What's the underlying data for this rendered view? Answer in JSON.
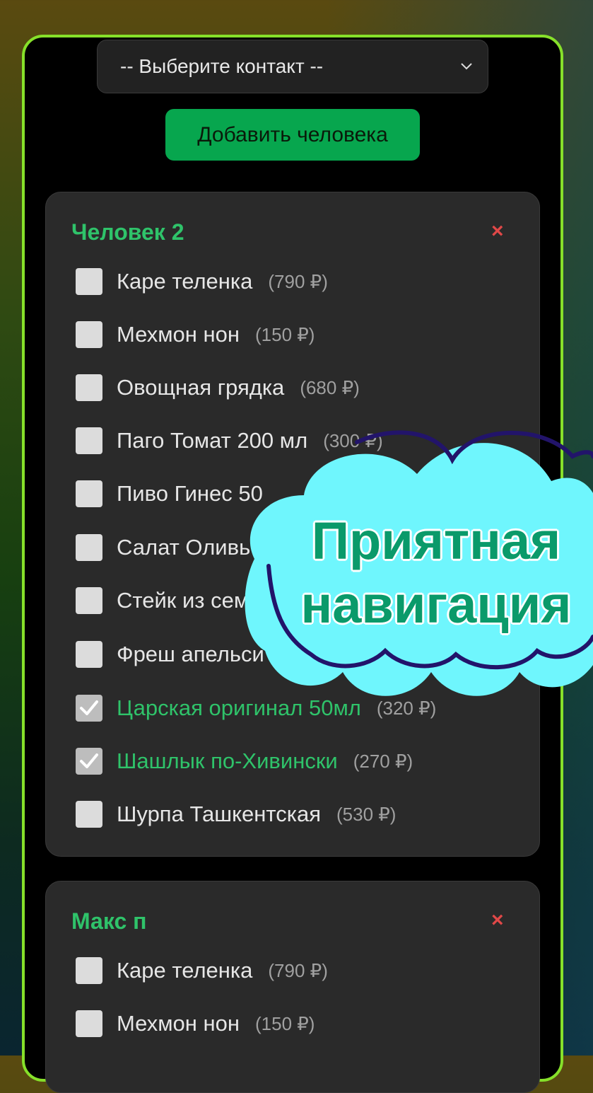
{
  "select": {
    "value": "-- Выберите контакт --"
  },
  "add_button": {
    "label": "Добавить человека"
  },
  "cards": [
    {
      "title": "Человек 2",
      "close": "×",
      "items": [
        {
          "name": "Каре теленка",
          "price": "(790 ₽)",
          "checked": false
        },
        {
          "name": "Мехмон нон",
          "price": "(150 ₽)",
          "checked": false
        },
        {
          "name": "Овощная грядка",
          "price": "(680 ₽)",
          "checked": false
        },
        {
          "name": "Паго Томат 200 мл",
          "price": "(300 ₽)",
          "checked": false
        },
        {
          "name": "Пиво Гинес 50",
          "price": "",
          "checked": false
        },
        {
          "name": "Салат Оливье",
          "price": "",
          "checked": false
        },
        {
          "name": "Стейк из сем",
          "price": "",
          "checked": false
        },
        {
          "name": "Фреш апельси",
          "price": "",
          "checked": false
        },
        {
          "name": "Царская оригинал 50мл",
          "price": "(320 ₽)",
          "checked": true
        },
        {
          "name": "Шашлык по-Хивински",
          "price": "(270 ₽)",
          "checked": true
        },
        {
          "name": "Шурпа Ташкентская",
          "price": "(530 ₽)",
          "checked": false
        }
      ]
    },
    {
      "title": "Макс п",
      "close": "×",
      "items": [
        {
          "name": "Каре теленка",
          "price": "(790 ₽)",
          "checked": false
        },
        {
          "name": "Мехмон нон",
          "price": "(150 ₽)",
          "checked": false
        }
      ]
    }
  ],
  "promo": {
    "line1": "Приятная",
    "line2": "навигация"
  },
  "colors": {
    "accent": "#2fc36a",
    "button": "#07a64e",
    "frame": "#86e02a",
    "close": "#e04848",
    "cloud": "#6ff6fd"
  }
}
